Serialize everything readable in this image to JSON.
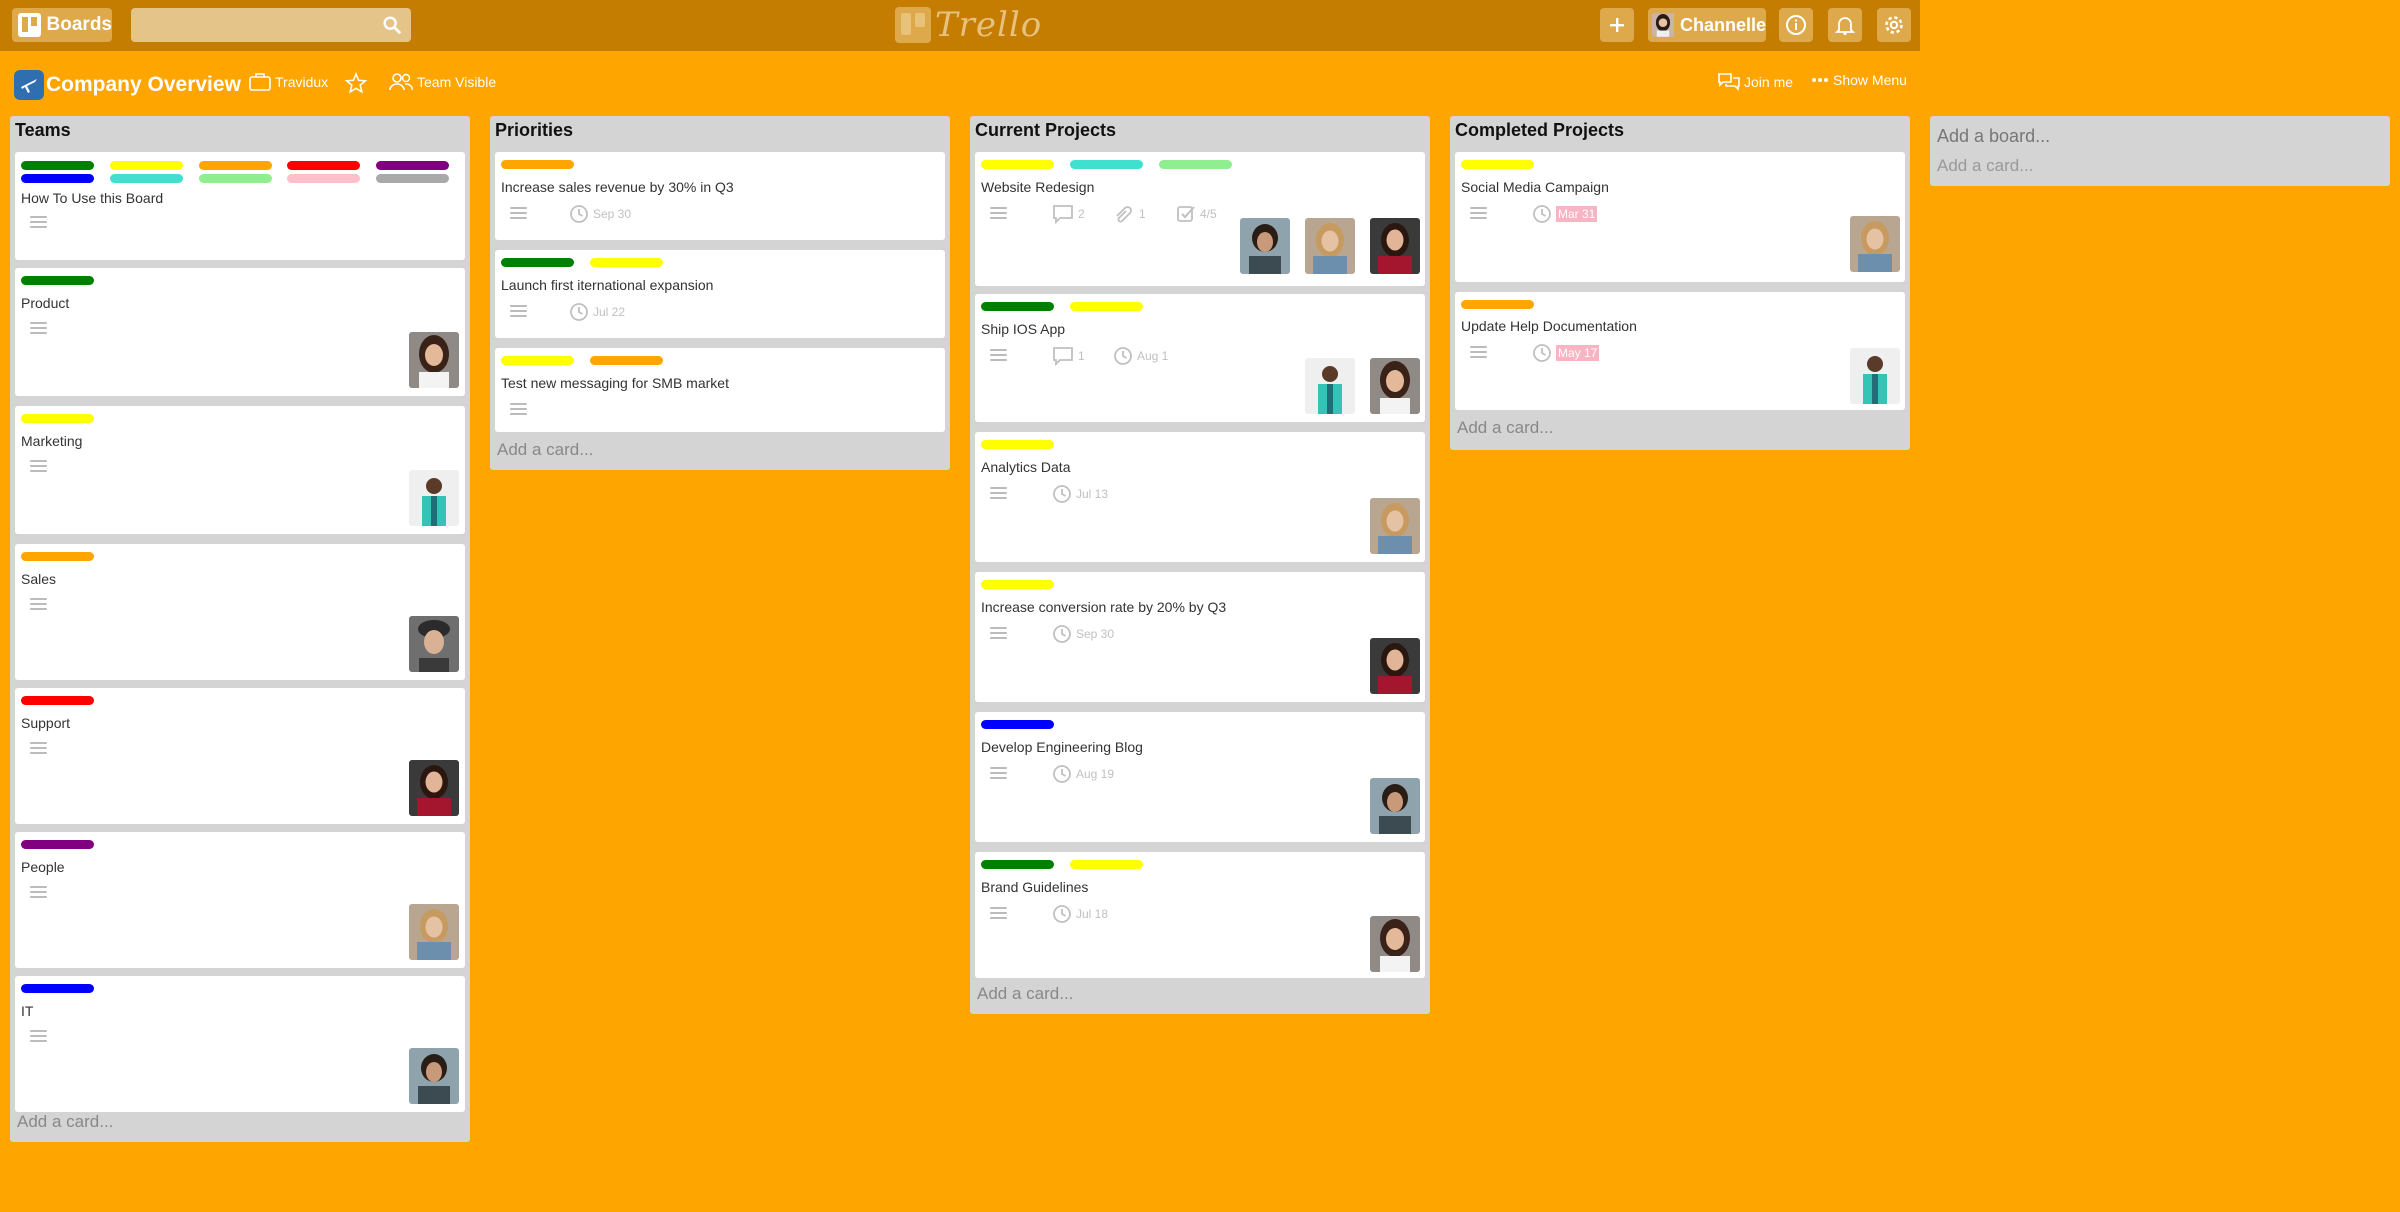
{
  "header": {
    "boards_label": "Boards",
    "search_placeholder": "",
    "logo_text": "Trello",
    "user_name": "Channelle"
  },
  "board": {
    "title": "Company Overview",
    "team_name": "Travidux",
    "visibility": "Team Visible",
    "join_label": "Join me",
    "menu_label": "Show Menu"
  },
  "colors": {
    "green": "#008000",
    "yellow": "#ffff00",
    "orange": "#ffa500",
    "red": "#ff0000",
    "purple": "#800080",
    "blue": "#0000ff",
    "teal": "#40e0d0",
    "lightgreen": "#90ee90",
    "pink": "#ffc0cb",
    "gray": "#a9a9a9"
  },
  "lists": [
    {
      "title": "Teams",
      "add_card": "Add a card...",
      "cards": [
        {
          "title": "How To Use this Board",
          "labels": [
            "green",
            "yellow",
            "orange",
            "red",
            "purple",
            "blue",
            "teal",
            "lightgreen",
            "pink",
            "gray"
          ]
        },
        {
          "title": "Product",
          "labels": [
            "green"
          ],
          "avatar": "woman-dark-hair"
        },
        {
          "title": "Marketing",
          "labels": [
            "yellow"
          ],
          "avatar": "man-teal-shirt"
        },
        {
          "title": "Sales",
          "labels": [
            "orange"
          ],
          "avatar": "woman-hat"
        },
        {
          "title": "Support",
          "labels": [
            "red"
          ],
          "avatar": "woman-red-top"
        },
        {
          "title": "People",
          "labels": [
            "purple"
          ],
          "avatar": "woman-denim"
        },
        {
          "title": "IT",
          "labels": [
            "blue"
          ],
          "avatar": "man-curly-hair"
        }
      ]
    },
    {
      "title": "Priorities",
      "add_card": "Add a card...",
      "cards": [
        {
          "title": "Increase sales revenue by 30% in Q3",
          "labels": [
            "orange"
          ],
          "due": "Sep 30"
        },
        {
          "title": "Launch first iternational expansion",
          "labels": [
            "green",
            "yellow"
          ],
          "due": "Jul 22"
        },
        {
          "title": "Test new messaging for SMB market",
          "labels": [
            "yellow",
            "orange"
          ]
        }
      ]
    },
    {
      "title": "Current Projects",
      "add_card": "Add a card...",
      "cards": [
        {
          "title": "Website Redesign",
          "labels": [
            "yellow",
            "teal",
            "lightgreen"
          ],
          "comments": "2",
          "attachments": "1",
          "checklist": "4/5"
        },
        {
          "title": "Ship IOS App",
          "labels": [
            "green",
            "yellow"
          ],
          "comments": "1",
          "due": "Aug 1"
        },
        {
          "title": "Analytics Data",
          "labels": [
            "yellow"
          ],
          "due": "Jul 13"
        },
        {
          "title": "Increase conversion rate by 20% by Q3",
          "labels": [
            "yellow"
          ],
          "due": "Sep 30"
        },
        {
          "title": "Develop Engineering Blog",
          "labels": [
            "blue"
          ],
          "due": "Aug 19"
        },
        {
          "title": "Brand Guidelines",
          "labels": [
            "green",
            "yellow"
          ],
          "due": "Jul 18"
        }
      ]
    },
    {
      "title": "Completed Projects",
      "add_card": "Add a card...",
      "cards": [
        {
          "title": "Social Media Campaign",
          "labels": [
            "yellow"
          ],
          "due": "Mar 31"
        },
        {
          "title": "Update Help Documentation",
          "labels": [
            "orange"
          ],
          "due": "May 17"
        }
      ]
    }
  ],
  "add_board": {
    "title": "Add a board...",
    "add_card": "Add a card..."
  }
}
